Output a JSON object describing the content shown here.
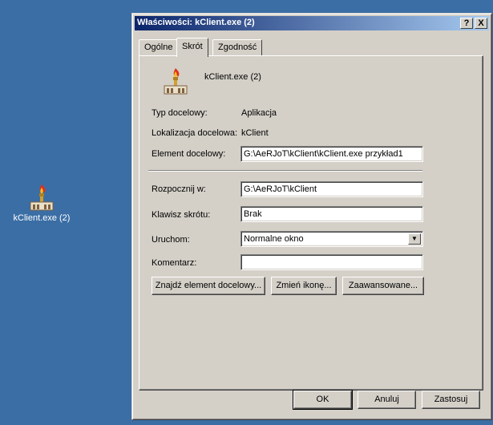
{
  "desktop": {
    "icon_label": "kClient.exe (2)"
  },
  "window": {
    "title": "Właściwości: kClient.exe (2)",
    "help_button": "?",
    "close_button": "X"
  },
  "tabs": [
    {
      "label": "Ogólne"
    },
    {
      "label": "Skrót"
    },
    {
      "label": "Zgodność"
    }
  ],
  "shortcut": {
    "name": "kClient.exe (2)",
    "target_type_label": "Typ docelowy:",
    "target_type_value": "Aplikacja",
    "target_location_label": "Lokalizacja docelowa:",
    "target_location_value": "kClient",
    "target_label": "Element docelowy:",
    "target_value": "G:\\AeRJoT\\kClient\\kClient.exe przykład1",
    "start_in_label": "Rozpocznij w:",
    "start_in_value": "G:\\AeRJoT\\kClient",
    "hotkey_label": "Klawisz skrótu:",
    "hotkey_value": "Brak",
    "run_label": "Uruchom:",
    "run_value": "Normalne okno",
    "comment_label": "Komentarz:",
    "comment_value": "",
    "find_target_button": "Znajdź element docelowy...",
    "change_icon_button": "Zmień ikonę...",
    "advanced_button": "Zaawansowane..."
  },
  "footer": {
    "ok": "OK",
    "cancel": "Anuluj",
    "apply": "Zastosuj"
  },
  "icons": {
    "app_icon": "torch-trophy-icon",
    "dropdown": "chevron-down-icon"
  }
}
